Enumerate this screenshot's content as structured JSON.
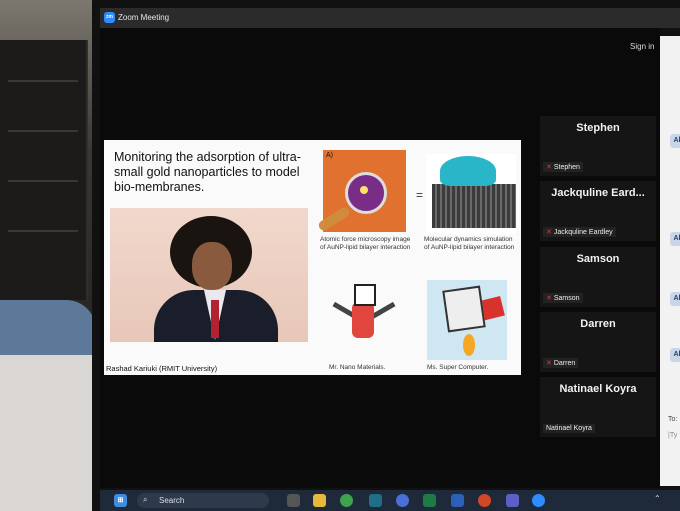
{
  "window": {
    "app_icon": "zm",
    "title": "Zoom Meeting",
    "sign_in": "Sign in"
  },
  "slide": {
    "title": "Monitoring the adsorption of ultra-small gold nanoparticles to model bio-membranes.",
    "afm_label": "A)",
    "afm_caption": "Atomic force microscopy image of AuNP-lipid bilayer interaction",
    "md_caption": "Molecular dynamics simulation of AuNP-lipid bilayer interaction",
    "equals": "=",
    "nano_caption": "Mr. Nano Materials.",
    "comp_caption": "Ms. Super Computer.",
    "speaker": "Rashad Kariuki (RMIT University)"
  },
  "participants": [
    {
      "name": "Stephen",
      "label": "Stephen",
      "muted": true
    },
    {
      "name": "Jackquline Eard...",
      "label": "Jackquline Eardley",
      "muted": true
    },
    {
      "name": "Samson",
      "label": "Samson",
      "muted": true
    },
    {
      "name": "Darren",
      "label": "Darren",
      "muted": true
    },
    {
      "name": "Natinael Koyra",
      "label": "Natinael Koyra",
      "muted": false
    }
  ],
  "right_panel": {
    "avatars": [
      "Al",
      "Al",
      "Al",
      "Al"
    ],
    "to": "To:",
    "typing": "|Ty"
  },
  "taskbar": {
    "search": "Search"
  },
  "colors": {
    "zoom_blue": "#2d8cff",
    "muted_red": "#e03a3a",
    "taskbar": "#1e2a3a"
  }
}
